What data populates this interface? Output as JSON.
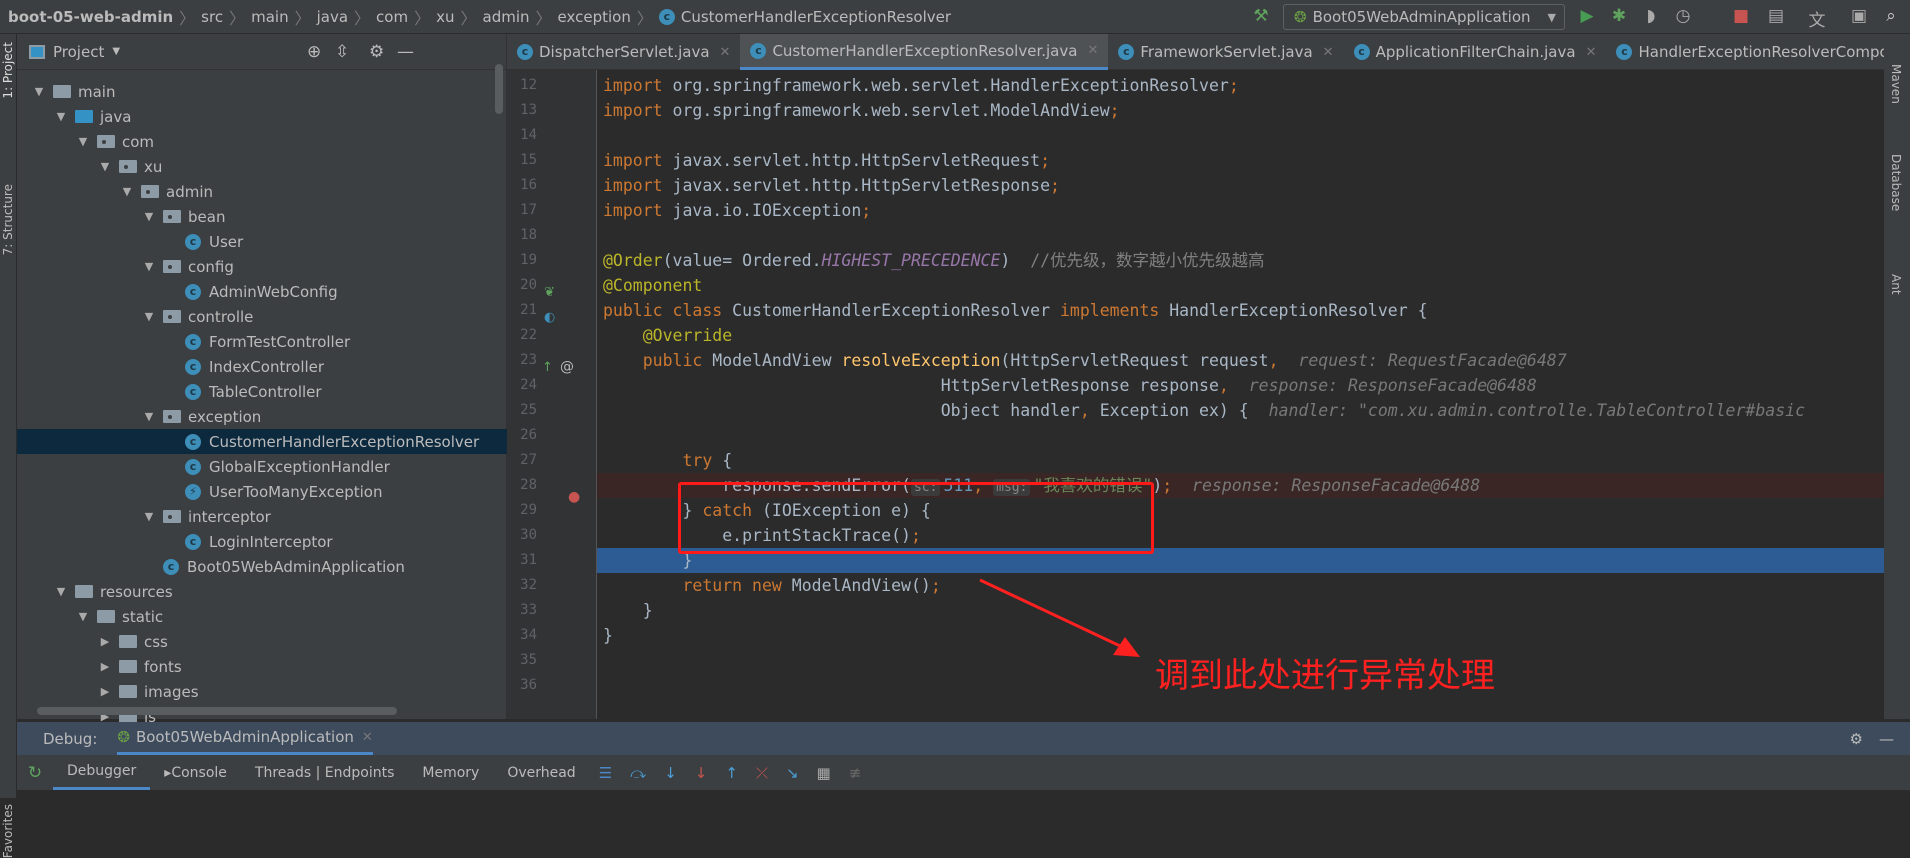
{
  "breadcrumb": [
    "boot-05-web-admin",
    "src",
    "main",
    "java",
    "com",
    "xu",
    "admin",
    "exception",
    "CustomerHandlerExceptionResolver"
  ],
  "toolbar": {
    "run_config": "Boot05WebAdminApplication",
    "icons": [
      "build-hammer-icon",
      "run-icon",
      "debug-icon",
      "coverage-icon",
      "profile-icon",
      "stop-icon",
      "project-structure-icon",
      "translate-icon",
      "terminal-icon",
      "search-icon"
    ]
  },
  "left_stripe": {
    "project": "1: Project",
    "structure": "7: Structure",
    "favorites": "Favorites"
  },
  "right_stripe": {
    "maven": "Maven",
    "database": "Database",
    "ant": "Ant"
  },
  "project": {
    "title": "Project",
    "tree": [
      {
        "label": "main",
        "depth": 0,
        "type": "folder",
        "expanded": true
      },
      {
        "label": "java",
        "depth": 1,
        "type": "src",
        "expanded": true
      },
      {
        "label": "com",
        "depth": 2,
        "type": "pkg",
        "expanded": true
      },
      {
        "label": "xu",
        "depth": 3,
        "type": "pkg",
        "expanded": true
      },
      {
        "label": "admin",
        "depth": 4,
        "type": "pkg",
        "expanded": true
      },
      {
        "label": "bean",
        "depth": 5,
        "type": "pkg",
        "expanded": true
      },
      {
        "label": "User",
        "depth": 6,
        "type": "class"
      },
      {
        "label": "config",
        "depth": 5,
        "type": "pkg",
        "expanded": true
      },
      {
        "label": "AdminWebConfig",
        "depth": 6,
        "type": "class"
      },
      {
        "label": "controlle",
        "depth": 5,
        "type": "pkg",
        "expanded": true
      },
      {
        "label": "FormTestController",
        "depth": 6,
        "type": "class"
      },
      {
        "label": "IndexController",
        "depth": 6,
        "type": "class"
      },
      {
        "label": "TableController",
        "depth": 6,
        "type": "class"
      },
      {
        "label": "exception",
        "depth": 5,
        "type": "pkg",
        "expanded": true
      },
      {
        "label": "CustomerHandlerExceptionResolver",
        "depth": 6,
        "type": "class",
        "selected": true
      },
      {
        "label": "GlobalExceptionHandler",
        "depth": 6,
        "type": "class"
      },
      {
        "label": "UserTooManyException",
        "depth": 6,
        "type": "exception"
      },
      {
        "label": "interceptor",
        "depth": 5,
        "type": "pkg",
        "expanded": true
      },
      {
        "label": "LoginInterceptor",
        "depth": 6,
        "type": "class"
      },
      {
        "label": "Boot05WebAdminApplication",
        "depth": 5,
        "type": "app"
      },
      {
        "label": "resources",
        "depth": 1,
        "type": "folder",
        "expanded": true
      },
      {
        "label": "static",
        "depth": 2,
        "type": "folder",
        "expanded": true
      },
      {
        "label": "css",
        "depth": 3,
        "type": "folder",
        "expanded": false
      },
      {
        "label": "fonts",
        "depth": 3,
        "type": "folder",
        "expanded": false
      },
      {
        "label": "images",
        "depth": 3,
        "type": "folder",
        "expanded": false
      },
      {
        "label": "js",
        "depth": 3,
        "type": "folder",
        "expanded": false
      }
    ]
  },
  "tabs": [
    {
      "label": "DispatcherServlet.java"
    },
    {
      "label": "CustomerHandlerExceptionResolver.java",
      "active": true
    },
    {
      "label": "FrameworkServlet.java"
    },
    {
      "label": "ApplicationFilterChain.java"
    },
    {
      "label": "HandlerExceptionResolverCompo"
    }
  ],
  "code": [
    {
      "n": "12",
      "t": [
        [
          "import ",
          "kw"
        ],
        [
          "org.springframework.web.servlet.HandlerExceptionResolver",
          ""
        ],
        [
          ";",
          "kw"
        ]
      ]
    },
    {
      "n": "13",
      "t": [
        [
          "import ",
          "kw"
        ],
        [
          "org.springframework.web.servlet.ModelAndView",
          ""
        ],
        [
          ";",
          "kw"
        ]
      ]
    },
    {
      "n": "14",
      "t": []
    },
    {
      "n": "15",
      "t": [
        [
          "import ",
          "kw"
        ],
        [
          "javax.servlet.http.HttpServletRequest",
          ""
        ],
        [
          ";",
          "kw"
        ]
      ]
    },
    {
      "n": "16",
      "t": [
        [
          "import ",
          "kw"
        ],
        [
          "javax.servlet.http.HttpServletResponse",
          ""
        ],
        [
          ";",
          "kw"
        ]
      ]
    },
    {
      "n": "17",
      "t": [
        [
          "import ",
          "kw"
        ],
        [
          "java.io.IOException",
          ""
        ],
        [
          ";",
          "kw"
        ]
      ]
    },
    {
      "n": "18",
      "t": []
    },
    {
      "n": "19",
      "t": [
        [
          "@Order",
          "an"
        ],
        [
          "(value= Ordered.",
          ""
        ],
        [
          "HIGHEST_PRECEDENCE",
          "it"
        ],
        [
          ")  ",
          ""
        ],
        [
          "//优先级，数字越小优先级越高",
          "cm"
        ]
      ]
    },
    {
      "n": "20",
      "t": [
        [
          "@Component",
          "an"
        ]
      ]
    },
    {
      "n": "21",
      "t": [
        [
          "public class ",
          "kw"
        ],
        [
          "CustomerHandlerExceptionResolver ",
          ""
        ],
        [
          "implements ",
          "kw"
        ],
        [
          "HandlerExceptionResolver {",
          ""
        ]
      ]
    },
    {
      "n": "22",
      "t": [
        [
          "    ",
          ""
        ],
        [
          "@Override",
          "an"
        ]
      ]
    },
    {
      "n": "23",
      "t": [
        [
          "    ",
          ""
        ],
        [
          "public ",
          "kw"
        ],
        [
          "ModelAndView ",
          ""
        ],
        [
          "resolveException",
          "fn"
        ],
        [
          "(HttpServletRequest request",
          ""
        ],
        [
          ",",
          "kw"
        ],
        [
          "  request: RequestFacade@6487",
          "hint"
        ]
      ]
    },
    {
      "n": "24",
      "t": [
        [
          "                                  HttpServletResponse response",
          ""
        ],
        [
          ",",
          "kw"
        ],
        [
          "  response: ResponseFacade@6488",
          "hint"
        ]
      ]
    },
    {
      "n": "25",
      "t": [
        [
          "                                  Object handler",
          ""
        ],
        [
          ", ",
          "kw"
        ],
        [
          "Exception ex) {",
          ""
        ],
        [
          "  handler: \"com.xu.admin.controlle.TableController#basic",
          "hint"
        ]
      ]
    },
    {
      "n": "26",
      "t": []
    },
    {
      "n": "27",
      "t": [
        [
          "        ",
          ""
        ],
        [
          "try ",
          "kw"
        ],
        [
          "{",
          ""
        ]
      ]
    },
    {
      "n": "28",
      "bp": true,
      "t": [
        [
          "            response.sendError(",
          ""
        ],
        [
          "sc:",
          "pill"
        ],
        [
          "511",
          "nu"
        ],
        [
          ", ",
          "kw"
        ],
        [
          "msg:",
          "pill"
        ],
        [
          "\"我喜欢的错误\"",
          "st"
        ],
        [
          ")",
          ""
        ],
        [
          ";",
          "kw"
        ],
        [
          "  response: ResponseFacade@6488",
          "hint"
        ]
      ]
    },
    {
      "n": "29",
      "t": [
        [
          "        } ",
          ""
        ],
        [
          "catch ",
          "kw"
        ],
        [
          "(IOException e) {",
          ""
        ]
      ]
    },
    {
      "n": "30",
      "t": [
        [
          "            e.printStackTrace()",
          ""
        ],
        [
          ";",
          "kw"
        ]
      ]
    },
    {
      "n": "31",
      "cur": true,
      "t": [
        [
          "        }",
          ""
        ]
      ]
    },
    {
      "n": "32",
      "t": [
        [
          "        ",
          ""
        ],
        [
          "return new ",
          "kw"
        ],
        [
          "ModelAndView()",
          ""
        ],
        [
          ";",
          "kw"
        ]
      ]
    },
    {
      "n": "33",
      "t": [
        [
          "    }",
          ""
        ]
      ]
    },
    {
      "n": "34",
      "t": [
        [
          "}",
          ""
        ]
      ]
    },
    {
      "n": "35",
      "t": []
    },
    {
      "n": "36",
      "t": []
    }
  ],
  "annotation": "调到此处进行异常处理",
  "debug": {
    "label": "Debug:",
    "session": "Boot05WebAdminApplication",
    "tabs": [
      "Debugger",
      "Console",
      "Threads | Endpoints",
      "Memory",
      "Overhead"
    ],
    "icons": [
      "restore-layout-icon",
      "step-over-icon",
      "step-into-icon",
      "force-step-into-icon",
      "step-out-icon",
      "drop-frame-icon",
      "run-to-cursor-icon",
      "evaluate-expression-icon",
      "trace-icon"
    ]
  },
  "colors": {
    "accent": "#4a88c7",
    "selection": "#0d293e",
    "current_line": "#2d5c94",
    "annotation": "#ff2020"
  }
}
